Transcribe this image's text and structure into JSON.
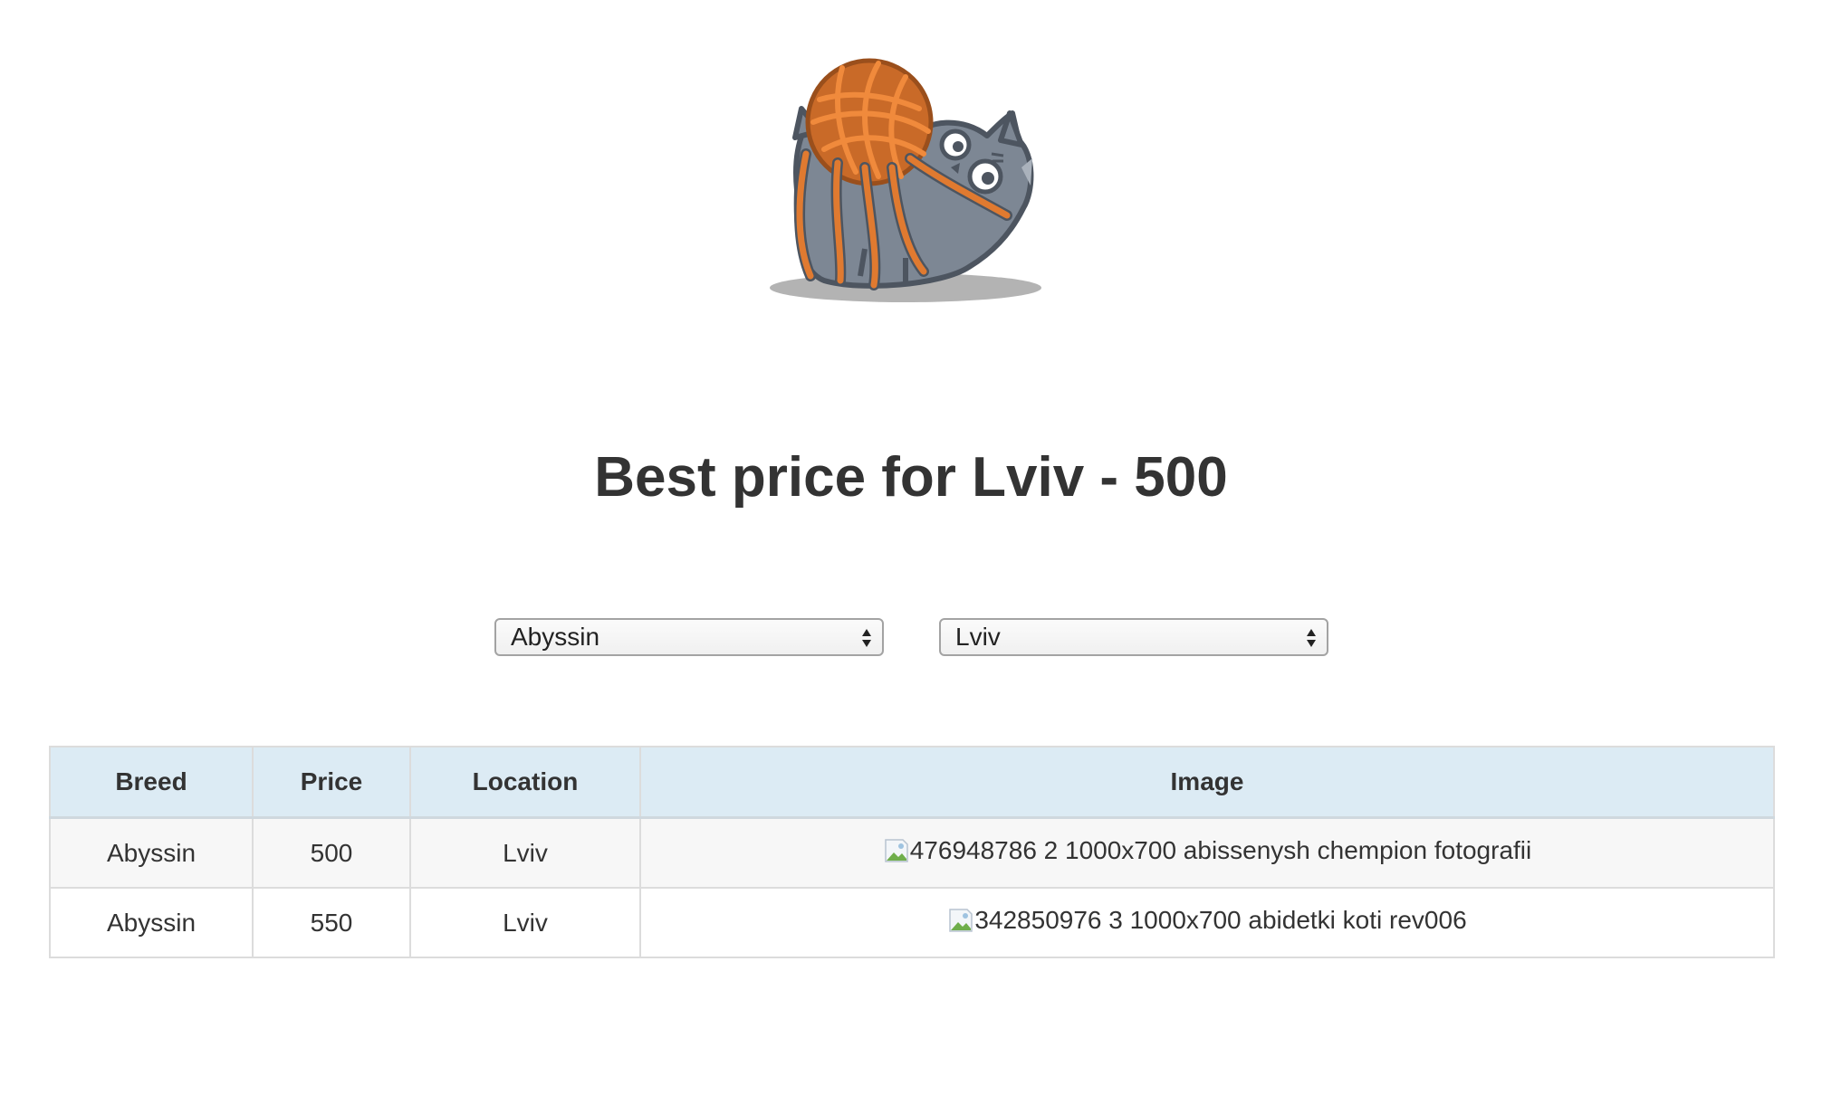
{
  "logo": {
    "icon": "cat-with-yarn-ball-logo"
  },
  "heading": {
    "title": "Best price for Lviv - 500"
  },
  "filters": {
    "breed": {
      "selected": "Abyssin"
    },
    "location": {
      "selected": "Lviv"
    }
  },
  "table": {
    "headers": {
      "breed": "Breed",
      "price": "Price",
      "location": "Location",
      "image": "Image"
    },
    "rows": [
      {
        "breed": "Abyssin",
        "price": "500",
        "location": "Lviv",
        "image_alt": "476948786 2 1000x700 abissenysh chempion fotografii"
      },
      {
        "breed": "Abyssin",
        "price": "550",
        "location": "Lviv",
        "image_alt": "342850976 3 1000x700 abidetki koti rev006"
      }
    ]
  },
  "colors": {
    "header_bg": "#dcebf4",
    "yarn": "#e07a30",
    "cat": "#7d8794"
  }
}
